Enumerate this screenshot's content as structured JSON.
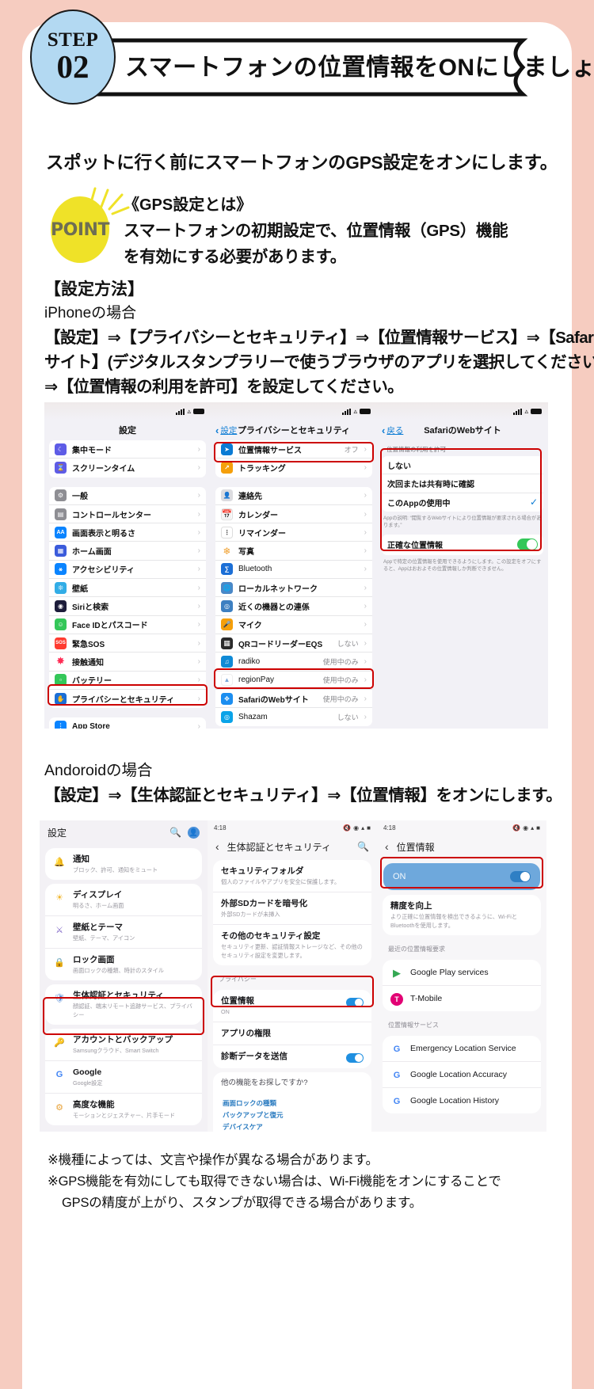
{
  "header": {
    "step_word": "STEP",
    "step_number": "02",
    "title": "スマートフォンの位置情報をONにしましょう"
  },
  "lead": "スポットに行く前にスマートフォンのGPS設定をオンにします。",
  "point": {
    "badge": "POINT",
    "heading": "《GPS設定とは》",
    "line1": "スマートフォンの初期設定で、位置情報（GPS）機能",
    "line2": "を有効にする必要があります。"
  },
  "howto": {
    "title": "【設定方法】",
    "subtitle": "iPhoneの場合",
    "line1": "【設定】⇒【プライバシーとセキュリティ】⇒【位置情報サービス】⇒【SafariのWeb",
    "line2": "サイト】(デジタルスタンプラリーで使うブラウザのアプリを選択してください）",
    "line3": "⇒【位置情報の利用を許可】を設定してください。"
  },
  "ios": {
    "pane1": {
      "nav_title": "設定",
      "group1": [
        {
          "label": "集中モード",
          "icon": "moon-icon",
          "color": "#5e5ce6"
        },
        {
          "label": "スクリーンタイム",
          "icon": "hourglass-icon",
          "color": "#5e5ce6"
        }
      ],
      "group2": [
        {
          "label": "一般",
          "icon": "gear-icon",
          "color": "#8e8e93"
        },
        {
          "label": "コントロールセンター",
          "icon": "control-center-icon",
          "color": "#8e8e93"
        },
        {
          "label": "画面表示と明るさ",
          "icon": "aa-icon",
          "color": "#0a84ff"
        },
        {
          "label": "ホーム画面",
          "icon": "home-screen-icon",
          "color": "#3b5bdb"
        },
        {
          "label": "アクセシビリティ",
          "icon": "accessibility-icon",
          "color": "#0a84ff"
        },
        {
          "label": "壁紙",
          "icon": "wallpaper-icon",
          "color": "#32ade6"
        },
        {
          "label": "Siriと検索",
          "icon": "siri-icon",
          "color": "#1c1c3a"
        },
        {
          "label": "Face IDとパスコード",
          "icon": "face-id-icon",
          "color": "#34c759"
        },
        {
          "label": "緊急SOS",
          "icon": "sos-icon",
          "color": "#ff3b30"
        },
        {
          "label": "接触通知",
          "icon": "exposure-notification-icon",
          "color": "#ff2d55"
        },
        {
          "label": "バッテリー",
          "icon": "battery-icon",
          "color": "#34c759"
        },
        {
          "label": "プライバシーとセキュリティ",
          "icon": "hand-privacy-icon",
          "color": "#1c6fd6",
          "highlight": true
        }
      ],
      "group3": [
        {
          "label": "App Store",
          "icon": "app-store-icon",
          "color": "#0a84ff"
        }
      ]
    },
    "pane2": {
      "back_label": "設定",
      "nav_title": "プライバシーとセキュリティ",
      "group1": [
        {
          "label": "位置情報サービス",
          "value": "オフ",
          "icon": "location-arrow-icon",
          "color": "#0a7bd4",
          "highlight": true
        },
        {
          "label": "トラッキング",
          "value": "",
          "icon": "tracking-icon",
          "color": "#f59f0a"
        }
      ],
      "group2": [
        {
          "label": "連絡先",
          "value": "",
          "icon": "contacts-icon",
          "color": "#b8b8bd"
        },
        {
          "label": "カレンダー",
          "value": "",
          "icon": "calendar-icon",
          "color": "#ffffff"
        },
        {
          "label": "リマインダー",
          "value": "",
          "icon": "reminders-icon",
          "color": "#ffffff"
        },
        {
          "label": "写真",
          "value": "",
          "icon": "photos-icon",
          "color": "#ffffff"
        },
        {
          "label": "Bluetooth",
          "value": "",
          "icon": "bluetooth-icon",
          "color": "#1c6fd6"
        },
        {
          "label": "ローカルネットワーク",
          "value": "",
          "icon": "local-network-icon",
          "color": "#4a88c7"
        },
        {
          "label": "近くの機器との連係",
          "value": "",
          "icon": "nearby-devices-icon",
          "color": "#3d7fc1"
        },
        {
          "label": "マイク",
          "value": "",
          "icon": "microphone-icon",
          "color": "#f59f0a"
        },
        {
          "label": "QRコードリーダーEQS",
          "value": "しない",
          "icon": "qr-reader-icon",
          "color": "#2b2b2b"
        },
        {
          "label": "radiko",
          "value": "使用中のみ",
          "icon": "radiko-icon",
          "color": "#0f8ad6"
        },
        {
          "label": "regionPay",
          "value": "使用中のみ",
          "icon": "regionpay-icon",
          "color": "#ffffff"
        },
        {
          "label": "SafariのWebサイト",
          "value": "使用中のみ",
          "icon": "safari-icon",
          "color": "#1c8ef0",
          "highlight": true
        },
        {
          "label": "Shazam",
          "value": "しない",
          "icon": "shazam-icon",
          "color": "#0aa3e8"
        }
      ]
    },
    "pane3": {
      "back_label": "戻る",
      "nav_title": "SafariのWebサイト",
      "section_header": "位置情報の利用を許可",
      "options": [
        {
          "label": "しない",
          "checked": false
        },
        {
          "label": "次回または共有時に確認",
          "checked": false
        },
        {
          "label": "このAppの使用中",
          "checked": true
        }
      ],
      "note1": "Appの説明: “閲覧するWebサイトにより位置情報が要求される場合があります。”",
      "precise": {
        "label": "正確な位置情報",
        "on": true
      },
      "note2": "Appで特定の位置情報を使用できるようにします。この設定をオフにすると、Appはおおよその位置情報しか判断できません。"
    }
  },
  "android_head": {
    "line1": "Andoroidの場合",
    "line2": "【設定】⇒【生体認証とセキュリティ】⇒【位置情報】をオンにします。"
  },
  "android": {
    "pane1": {
      "title": "設定",
      "search_icon": "search-icon",
      "account_icon": "account-icon",
      "items": [
        {
          "t1": "通知",
          "t2": "ブロック、許可、通知をミュート",
          "icon": "notification-icon",
          "color": "#e8536a"
        },
        {
          "t1": "ディスプレイ",
          "t2": "明るさ、ホーム画面",
          "icon": "display-icon",
          "color": "#f0b429"
        },
        {
          "t1": "壁紙とテーマ",
          "t2": "壁紙、テーマ、アイコン",
          "icon": "wallpaper-theme-icon",
          "color": "#7a5fc4"
        },
        {
          "t1": "ロック画面",
          "t2": "画面ロックの種類、時計のスタイル",
          "icon": "lock-screen-icon",
          "color": "#8a6fd0"
        },
        {
          "t1": "生体認証とセキュリティ",
          "t2": "顔認証、端末リモート追跡サービス、プライバシー",
          "icon": "shield-icon",
          "color": "#5a8fd8",
          "highlight": true
        },
        {
          "t1": "アカウントとバックアップ",
          "t2": "Samsungクラウド、Smart Switch",
          "icon": "account-backup-icon",
          "color": "#e0a33a"
        },
        {
          "t1": "Google",
          "t2": "Google設定",
          "icon": "google-icon",
          "color": "#4285f4"
        },
        {
          "t1": "高度な機能",
          "t2": "モーションとジェスチャー、片手モード",
          "icon": "advanced-icon",
          "color": "#e8a33a"
        }
      ]
    },
    "pane2": {
      "time": "4:18",
      "back_icon": "back-arrow-icon",
      "title": "生体認証とセキュリティ",
      "search_icon": "search-icon",
      "items": [
        {
          "t1": "セキュリティフォルダ",
          "t2": "個人のファイルやアプリを安全に保護します。"
        },
        {
          "t1": "外部SDカードを暗号化",
          "t2": "外部SDカードが未挿入"
        },
        {
          "t1": "その他のセキュリティ設定",
          "t2": "セキュリティ更新、認証情報ストレージなど、その他のセキュリティ設定を変更します。"
        }
      ],
      "section": "プライバシー",
      "location_row": {
        "t1": "位置情報",
        "t2": "ON",
        "toggle": true,
        "highlight": true
      },
      "items2": [
        {
          "t1": "アプリの権限",
          "t2": ""
        },
        {
          "t1": "診断データを送信",
          "t2": "",
          "toggle": true
        }
      ],
      "find_more": "他の機能をお探しですか?",
      "links": [
        "画面ロックの種類",
        "バックアップと復元",
        "デバイスケア"
      ]
    },
    "pane3": {
      "time": "4:18",
      "back_icon": "back-arrow-icon",
      "title": "位置情報",
      "on_bar": {
        "label": "ON",
        "on": true,
        "highlight": true
      },
      "accuracy": {
        "t1": "精度を向上",
        "t2": "より正確に位置情報を検出できるように、Wi-FiとBluetoothを使用します。"
      },
      "section1": "最近の位置情報要求",
      "recent": [
        {
          "label": "Google Play services",
          "icon": "google-play-icon"
        },
        {
          "label": "T-Mobile",
          "icon": "t-mobile-icon"
        }
      ],
      "section2": "位置情報サービス",
      "services": [
        {
          "label": "Emergency Location Service",
          "icon": "google-g-icon"
        },
        {
          "label": "Google Location Accuracy",
          "icon": "google-g-icon"
        },
        {
          "label": "Google Location History",
          "icon": "google-g-icon"
        }
      ]
    }
  },
  "notes": [
    "※機種によっては、文言や操作が異なる場合があります。",
    "※GPS機能を有効にしても取得できない場合は、Wi-Fi機能をオンにすることで",
    "GPSの精度が上がり、スタンプが取得できる場合があります。"
  ],
  "colors": {
    "page_bg": "#f6ccc0",
    "accent_red": "#cc0000",
    "badge_blue": "#b3d9f2",
    "point_yellow": "#efe228",
    "ios_blue": "#0a7bd4",
    "android_blue": "#6ea8dc"
  }
}
